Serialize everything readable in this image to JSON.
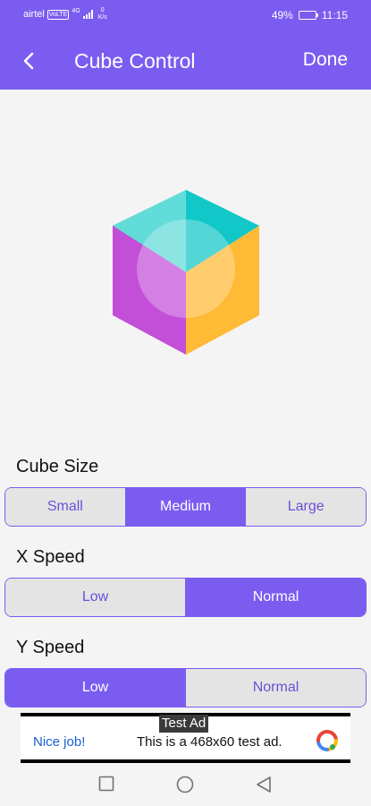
{
  "status_bar": {
    "carrier": "airtel",
    "volte": "VoLTE",
    "network": "4G",
    "speed_value": "0",
    "speed_unit": "K/s",
    "battery": "49%",
    "battery_level": 0.49,
    "time": "11:15"
  },
  "header": {
    "back_icon": "chevron-left-icon",
    "title": "Cube Control",
    "done_label": "Done"
  },
  "cube": {
    "colors": {
      "top_left": "#62dcd8",
      "top_right": "#12c7c7",
      "left": "#c34ed8",
      "right": "#ffba36",
      "center_circle": "#ffffff"
    }
  },
  "cube_size": {
    "label": "Cube Size",
    "options": [
      "Small",
      "Medium",
      "Large"
    ],
    "selected": "Medium"
  },
  "x_speed": {
    "label": "X Speed",
    "options": [
      "Low",
      "Normal"
    ],
    "selected": "Normal"
  },
  "y_speed": {
    "label": "Y Speed",
    "options": [
      "Low",
      "Normal"
    ],
    "selected": "Low"
  },
  "ad": {
    "tag": "Test Ad",
    "nice_text": "Nice job!",
    "body_text": "This is a 468x60 test ad.",
    "logo_icon": "ad-logo-icon"
  },
  "nav": {
    "recents_icon": "square-icon",
    "home_icon": "circle-icon",
    "back_icon": "triangle-back-icon"
  },
  "colors": {
    "accent": "#7b5cf0",
    "unselected_bg": "#e4e4e4",
    "background": "#f4f4f4"
  }
}
